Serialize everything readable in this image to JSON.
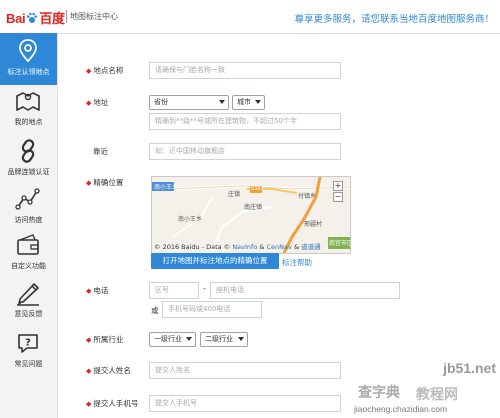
{
  "header": {
    "logo_left": "Bai",
    "logo_right": "百度",
    "logo_sub": "地图标注中心",
    "notice": "尊享更多服务，请您联系当地百度地图服务商！"
  },
  "sidebar": {
    "items": [
      {
        "label": "标注认领地点",
        "icon": "location-pin-icon",
        "active": true
      },
      {
        "label": "我的地点",
        "icon": "map-icon",
        "active": false
      },
      {
        "label": "品牌连锁认证",
        "icon": "link-icon",
        "active": false
      },
      {
        "label": "访问热度",
        "icon": "trend-line-icon",
        "active": false
      },
      {
        "label": "自定义功能",
        "icon": "wallet-icon",
        "active": false
      },
      {
        "label": "意见反馈",
        "icon": "pencil-icon",
        "active": false
      },
      {
        "label": "常见问题",
        "icon": "question-icon",
        "active": false
      }
    ]
  },
  "form": {
    "name": {
      "label": "地点名称",
      "placeholder": "请确保与门脸名称一致"
    },
    "address": {
      "label": "地址",
      "province": "省份",
      "city": "城市",
      "placeholder": "精确到**路**号或所在建筑物，不超过50个字"
    },
    "near": {
      "label": "靠近",
      "placeholder": "如：近中国移动旗舰店"
    },
    "location": {
      "label": "精确位置",
      "map_labels": [
        "南小王乡",
        "庄镇",
        "南庄镇",
        "S303",
        "邢疆村",
        "付镇乡",
        "南宫市区",
        "南小王乡"
      ],
      "copyright": "© 2016 Baidu - Data © ",
      "copyright_links": [
        "NavInfo",
        "CenNav",
        "道道通"
      ],
      "copyright_amp": " & ",
      "button": "打开地图并标注地点的精确位置",
      "help": "标注帮助"
    },
    "phone": {
      "label": "电话",
      "area_placeholder": "区号",
      "dash": "-",
      "fixed_placeholder": "座机电话",
      "or": "或",
      "mobile_placeholder": "手机号码或400电话"
    },
    "industry": {
      "label": "所属行业",
      "level1": "一级行业",
      "level2": "二级行业"
    },
    "submitter_name": {
      "label": "提交人姓名",
      "placeholder": "提交人姓名"
    },
    "submitter_phone": {
      "label": "提交人手机号",
      "placeholder": "提交人手机号"
    }
  },
  "watermark": {
    "line1": "查字典",
    "line2": "教程网",
    "site1": "jb51.net",
    "site2": "jiaocheng.chazidian.com"
  },
  "colors": {
    "brand_blue": "#2f87d8",
    "brand_red": "#e1251b"
  }
}
